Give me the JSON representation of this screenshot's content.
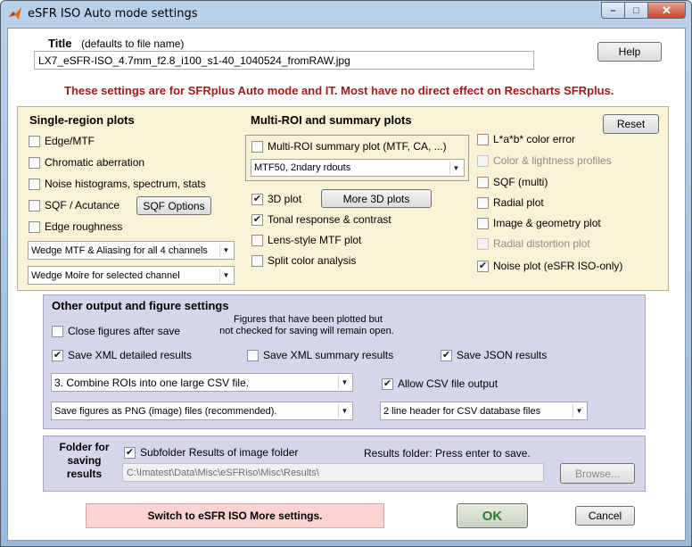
{
  "window": {
    "title": "eSFR ISO Auto mode settings"
  },
  "title_section": {
    "label": "Title",
    "hint": "(defaults to file name)",
    "value": "LX7_eSFR-ISO_4.7mm_f2.8_i100_s1-40_1040524_fromRAW.jpg",
    "help_label": "Help"
  },
  "notice": "These settings are for SFRplus Auto mode and IT. Most have no direct effect on Rescharts SFRplus.",
  "single_region": {
    "heading": "Single-region plots",
    "items": [
      {
        "label": "Edge/MTF",
        "checked": false
      },
      {
        "label": "Chromatic aberration",
        "checked": false
      },
      {
        "label": "Noise histograms, spectrum, stats",
        "checked": false
      },
      {
        "label": "SQF / Acutance",
        "checked": false
      },
      {
        "label": "Edge roughness",
        "checked": false
      }
    ],
    "sqf_options_label": "SQF Options",
    "select1": "Wedge MTF & Aliasing for all 4 channels",
    "select2": "Wedge Moire for selected channel"
  },
  "multi_roi": {
    "heading": "Multi-ROI and summary plots",
    "summary_label": "Multi-ROI summary plot (MTF, CA, ...)",
    "summary_checked": false,
    "summary_select": "MTF50, 2ndary rdouts",
    "items": [
      {
        "label": "3D plot",
        "checked": true
      },
      {
        "label": "Tonal response & contrast",
        "checked": true
      },
      {
        "label": "Lens-style MTF plot",
        "checked": false
      },
      {
        "label": "Split color analysis",
        "checked": false
      }
    ],
    "more3d_label": "More 3D plots"
  },
  "right_col": {
    "reset_label": "Reset",
    "items": [
      {
        "label": "L*a*b* color error",
        "checked": false,
        "disabled": false
      },
      {
        "label": "Color & lightness profiles",
        "checked": false,
        "disabled": true
      },
      {
        "label": "SQF (multi)",
        "checked": false,
        "disabled": false
      },
      {
        "label": "Radial plot",
        "checked": false,
        "disabled": false
      },
      {
        "label": "Image & geometry plot",
        "checked": false,
        "disabled": false
      },
      {
        "label": "Radial distortion plot",
        "checked": false,
        "disabled": true
      },
      {
        "label": "Noise plot  (eSFR ISO-only)",
        "checked": true,
        "disabled": false
      }
    ]
  },
  "other_output": {
    "heading": "Other output and figure settings",
    "close_figures_label": "Close figures after save",
    "close_figures_checked": false,
    "note_line1": "Figures that have been plotted but",
    "note_line2": "not checked for saving will remain open.",
    "save_xml_detailed_label": "Save XML detailed results",
    "save_xml_detailed_checked": true,
    "save_xml_summary_label": "Save XML summary results",
    "save_xml_summary_checked": false,
    "save_json_label": "Save JSON results",
    "save_json_checked": true,
    "csv_combine_select": "3. Combine ROIs into one large CSV file.",
    "allow_csv_label": "Allow CSV file output",
    "allow_csv_checked": true,
    "save_figures_select": "Save figures as PNG (image) files (recommended).",
    "csv_header_select": "2 line header for CSV database files"
  },
  "folder": {
    "label_line1": "Folder for",
    "label_line2": "saving",
    "label_line3": "results",
    "subfolder_label": "Subfolder Results of image folder",
    "subfolder_checked": true,
    "results_hint": "Results folder:  Press enter to save.",
    "path": "C:\\Imatest\\Data\\Misc\\eSFRiso\\Misc\\Results\\",
    "browse_label": "Browse..."
  },
  "bottom": {
    "switch_label": "Switch to eSFR ISO More settings.",
    "ok_label": "OK",
    "cancel_label": "Cancel"
  },
  "colors": {
    "notice_red": "#a01c1c",
    "yellow_panel": "#f8f2d6",
    "blue_panel": "#d6d6eb",
    "switch_pink": "#fbd3d3",
    "ok_green": "#2e7d2e"
  }
}
